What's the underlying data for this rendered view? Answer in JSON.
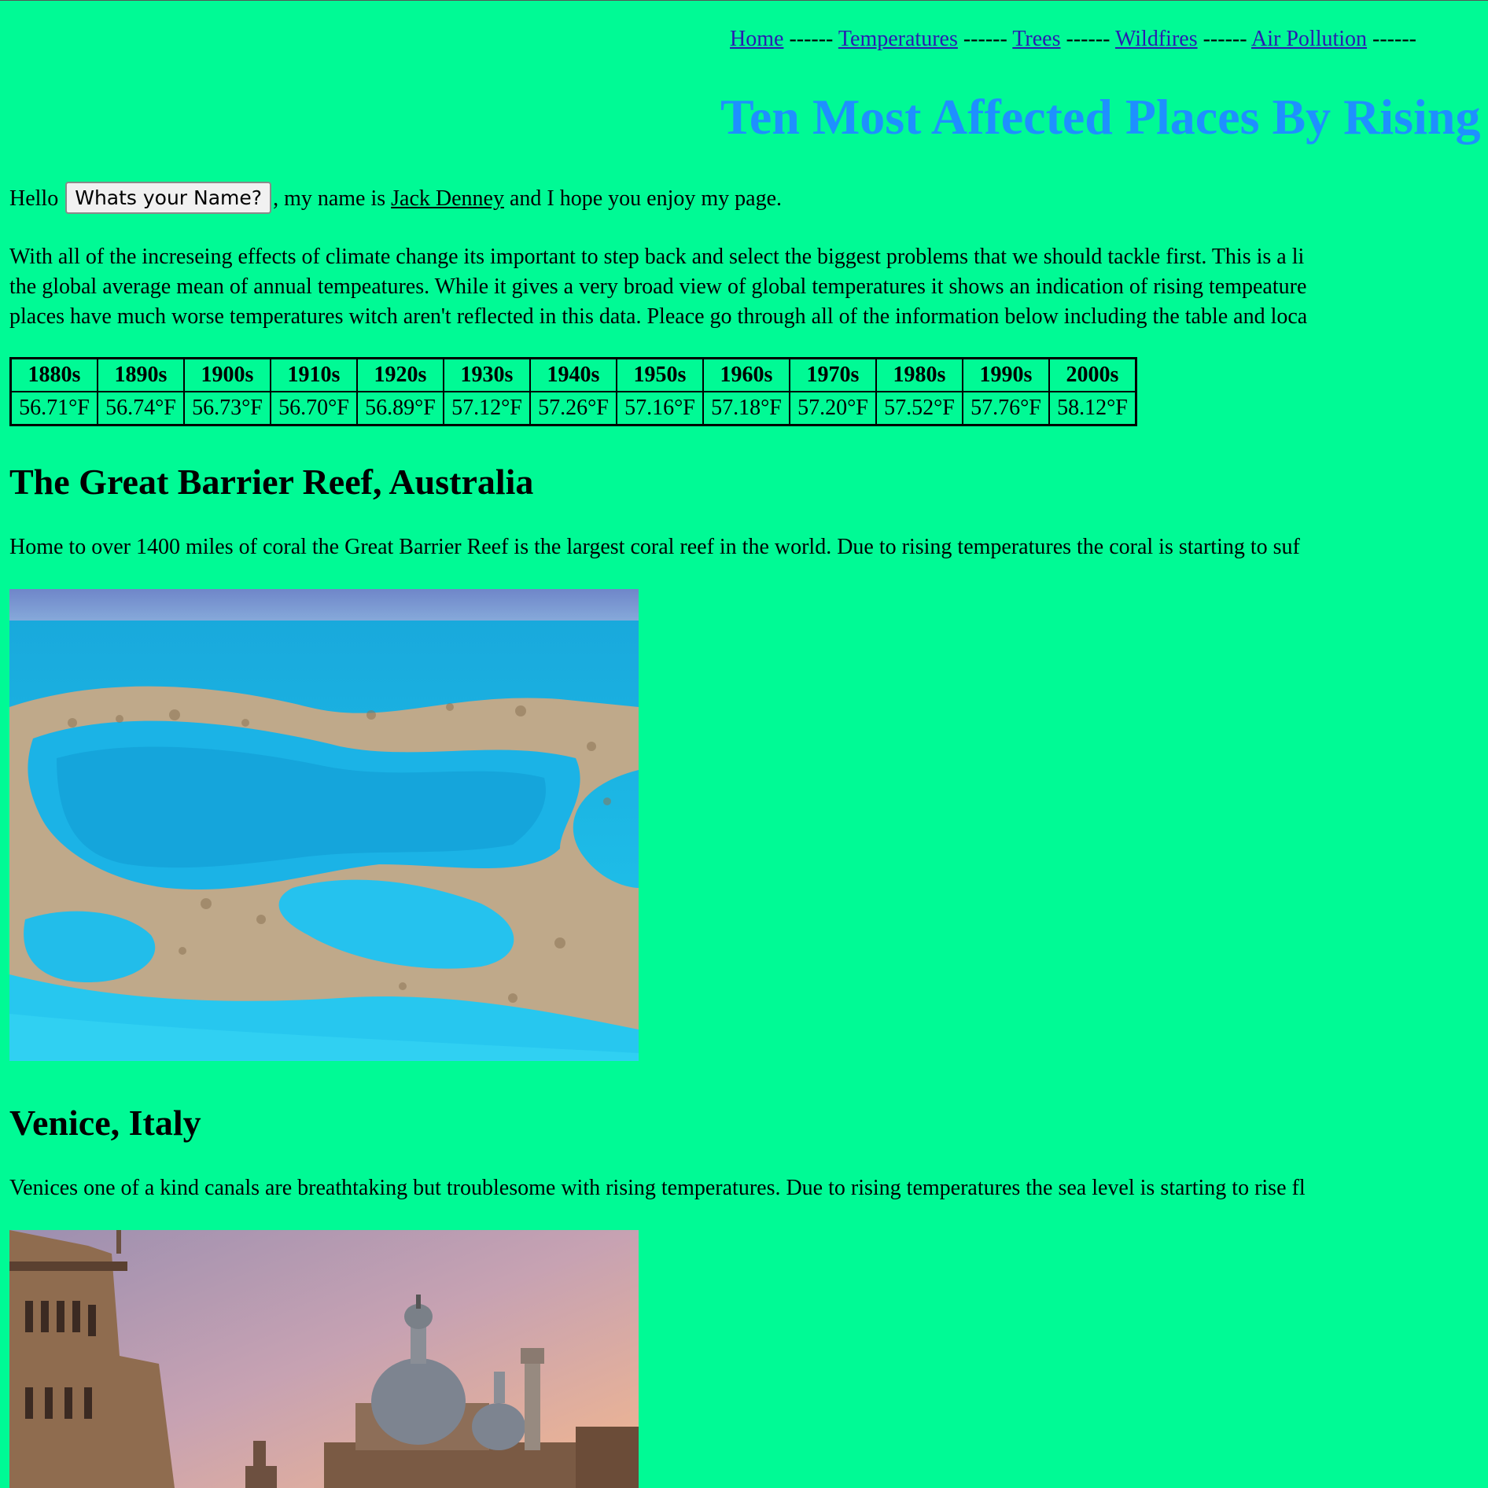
{
  "nav": {
    "links": [
      {
        "label": "Home"
      },
      {
        "label": "Temperatures"
      },
      {
        "label": "Trees"
      },
      {
        "label": "Wildfires"
      },
      {
        "label": "Air Pollution"
      }
    ],
    "separator": "------"
  },
  "page_title": "Ten Most Affected Places By Rising",
  "greeting": {
    "hello": "Hello",
    "button_label": "Whats your Name?",
    "middle": ", my name is",
    "author": "Jack Denney",
    "end": "and I hope you enjoy my page."
  },
  "intro": {
    "lines": [
      "With all of the increseing effects of climate change its important to step back and select the biggest problems that we should tackle first. This is a li",
      "the global average mean of annual tempeatures. While it gives a very broad view of global temperatures it shows an indication of rising tempeature",
      "places have much worse temperatures witch aren't reflected in this data. Pleace go through all of the information below including the table and loca"
    ]
  },
  "temp_table": {
    "headers": [
      "1880s",
      "1890s",
      "1900s",
      "1910s",
      "1920s",
      "1930s",
      "1940s",
      "1950s",
      "1960s",
      "1970s",
      "1980s",
      "1990s",
      "2000s"
    ],
    "values": [
      "56.71°F",
      "56.74°F",
      "56.73°F",
      "56.70°F",
      "56.89°F",
      "57.12°F",
      "57.26°F",
      "57.16°F",
      "57.18°F",
      "57.20°F",
      "57.52°F",
      "57.76°F",
      "58.12°F"
    ]
  },
  "sections": [
    {
      "heading": "The Great Barrier Reef, Australia",
      "text": "Home to over 1400 miles of coral the Great Barrier Reef is the largest coral reef in the world. Due to rising temperatures the coral is starting to suf"
    },
    {
      "heading": "Venice, Italy",
      "text": "Venices one of a kind canals are breathtaking but troublesome with rising temperatures. Due to rising temperatures the sea level is starting to rise fl"
    }
  ],
  "colors": {
    "background": "#00fa95",
    "title": "#1e90ff",
    "link": "#2a1bb0"
  }
}
